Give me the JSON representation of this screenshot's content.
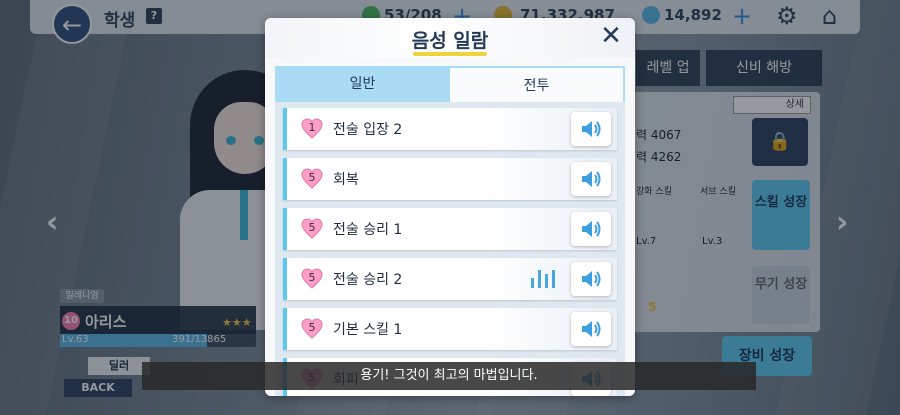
{
  "top_bar": {
    "title": "학생",
    "help": "?",
    "ap": "53/208",
    "credits": "71,332,987",
    "gems": "14,892"
  },
  "right_panel": {
    "tab_level": "레벨 업",
    "tab_limit": "신비 해방",
    "search": "상세",
    "stat1": "력 4067",
    "stat2": "력 4262",
    "skill_label1": "강화 스킬",
    "skill_label2": "서브 스킬",
    "skill_lv1": "Lv.7",
    "skill_lv2": "Lv.3",
    "skill_grow": "스킬 성장",
    "weapon_grow": "무기 성장",
    "weapon_star": "5",
    "equip_grow": "장비 성장"
  },
  "character": {
    "tag": "밀레니엄",
    "level_badge": "10",
    "name": "아리스",
    "stars": "★★★",
    "lv": "Lv.63",
    "exp": "391/13865",
    "exp_fraction": 0.75,
    "btn_role": "딜러",
    "btn_back": "BACK"
  },
  "modal": {
    "title": "음성 일람",
    "close": "✕",
    "tabs": [
      "일반",
      "전투"
    ],
    "active_tab": 0,
    "rows": [
      {
        "level": "1",
        "label": "전술 입장 2",
        "playing": false
      },
      {
        "level": "5",
        "label": "회복",
        "playing": false
      },
      {
        "level": "5",
        "label": "전술 승리 1",
        "playing": false
      },
      {
        "level": "5",
        "label": "전술 승리 2",
        "playing": true
      },
      {
        "level": "5",
        "label": "기본 스킬 1",
        "playing": false
      },
      {
        "level": "5",
        "label": "회피",
        "playing": false
      }
    ]
  },
  "subtitle": "용기! 그것이 최고의 마법입니다.",
  "colors": {
    "accent": "#5cc8f0",
    "heart": "#ff9ec7",
    "navy": "#243a58"
  }
}
